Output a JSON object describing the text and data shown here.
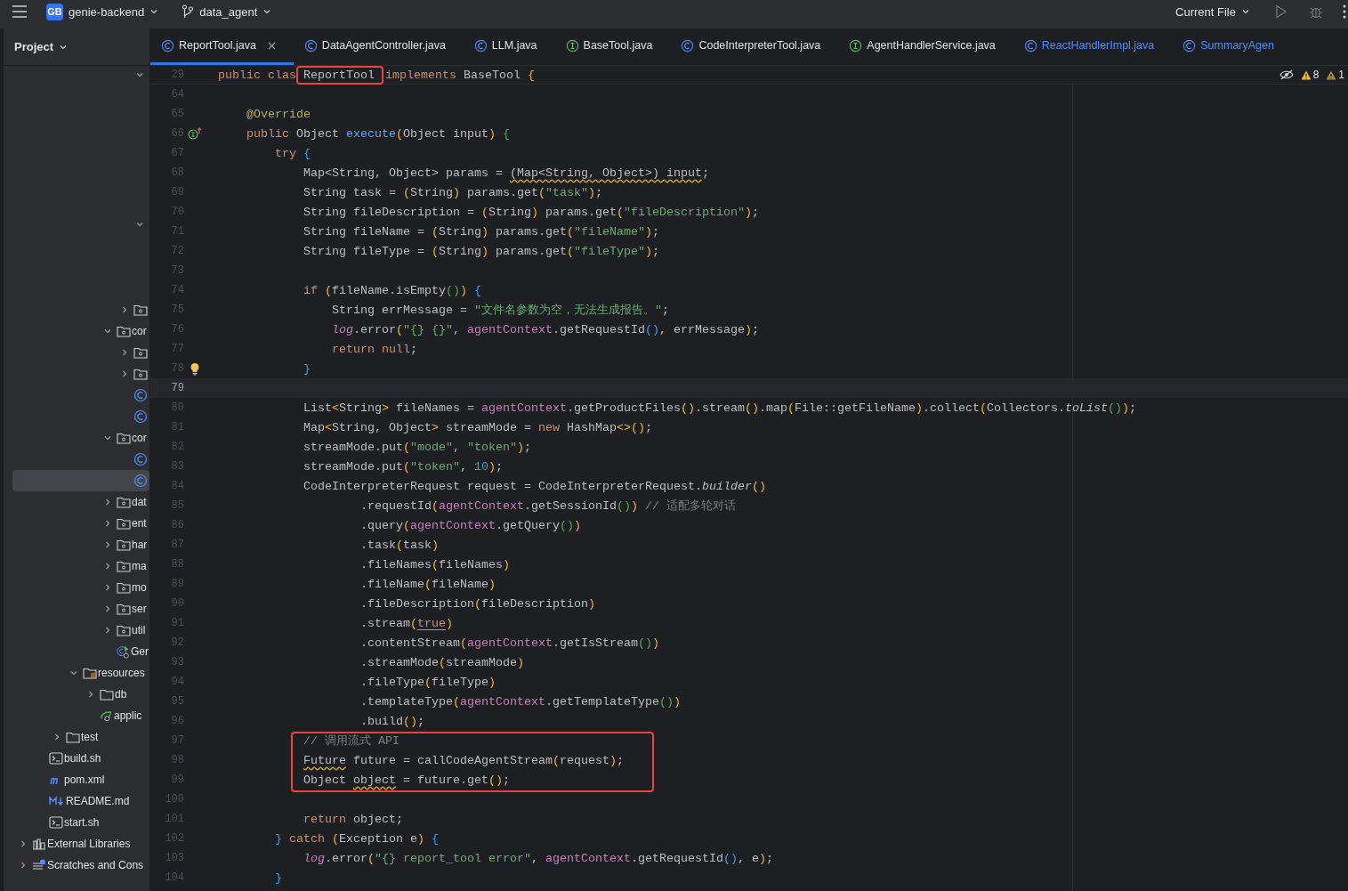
{
  "top_bar": {
    "project": {
      "badge": "GB",
      "name": "genie-backend"
    },
    "branch": "data_agent",
    "run_config": "Current File"
  },
  "sidebar": {
    "title": "Project",
    "tree": [
      {
        "kind": "continued",
        "children": [
          {
            "kind": "continued",
            "children": [
              {
                "kind": "continued",
                "children": [
                  {
                    "kind": "continued",
                    "children": [
                      {
                        "kind": "continued",
                        "children": [
                          {
                            "kind": "continued",
                            "children": [
                              {
                                "kind": "folder",
                                "expanded": false,
                                "selected": false
                              }
                            ]
                          },
                          {
                            "kind": "folder",
                            "label": "cor",
                            "expanded": true,
                            "selected": false,
                            "children": [
                              {
                                "kind": "folder",
                                "expanded": false,
                                "selected": false
                              },
                              {
                                "kind": "folder",
                                "expanded": false,
                                "selected": false
                              },
                              {
                                "kind": "class",
                                "selected": false
                              },
                              {
                                "kind": "class",
                                "selected": false
                              }
                            ]
                          },
                          {
                            "kind": "folder",
                            "label": "cor",
                            "expanded": true,
                            "selected": false,
                            "children": [
                              {
                                "kind": "class",
                                "selected": false
                              },
                              {
                                "kind": "class",
                                "selected": true
                              }
                            ]
                          },
                          {
                            "kind": "folder",
                            "label": "dat",
                            "expanded": false,
                            "selected": false
                          },
                          {
                            "kind": "folder",
                            "label": "ent",
                            "expanded": false,
                            "selected": false
                          },
                          {
                            "kind": "folder",
                            "label": "har",
                            "expanded": false,
                            "selected": false
                          },
                          {
                            "kind": "folder",
                            "label": "ma",
                            "expanded": false,
                            "selected": false
                          },
                          {
                            "kind": "folder",
                            "label": "mo",
                            "expanded": false,
                            "selected": false
                          },
                          {
                            "kind": "folder",
                            "label": "ser",
                            "expanded": false,
                            "selected": false
                          },
                          {
                            "kind": "folder",
                            "label": "util",
                            "expanded": false,
                            "selected": false
                          },
                          {
                            "kind": "spring-class",
                            "label": "Ger",
                            "selected": false
                          }
                        ]
                      }
                    ]
                  },
                  {
                    "kind": "resources-folder",
                    "label": "resources",
                    "expanded": true,
                    "selected": false,
                    "children": [
                      {
                        "kind": "plain-folder",
                        "label": "db",
                        "expanded": false,
                        "selected": false
                      },
                      {
                        "kind": "spring-config",
                        "label": "applic",
                        "selected": false
                      }
                    ]
                  }
                ]
              },
              {
                "kind": "plain-folder",
                "label": "test",
                "expanded": false,
                "selected": false
              }
            ]
          },
          {
            "kind": "shell-file",
            "label": "build.sh",
            "selected": false
          },
          {
            "kind": "maven-file",
            "label": "pom.xml",
            "selected": false
          },
          {
            "kind": "markdown-file",
            "label": "README.md",
            "selected": false
          },
          {
            "kind": "shell-file",
            "label": "start.sh",
            "selected": false
          }
        ]
      },
      {
        "kind": "libraries",
        "label": "External Libraries",
        "expanded": false,
        "selected": false
      },
      {
        "kind": "scratches",
        "label": "Scratches and Cons",
        "expanded": false,
        "selected": false
      }
    ]
  },
  "tabs": [
    {
      "label": "ReportTool.java",
      "kind": "class",
      "modified": false,
      "selected": true
    },
    {
      "label": "DataAgentController.java",
      "kind": "class",
      "modified": false,
      "selected": false
    },
    {
      "label": "LLM.java",
      "kind": "class",
      "modified": false,
      "selected": false
    },
    {
      "label": "BaseTool.java",
      "kind": "interface",
      "modified": false,
      "selected": false
    },
    {
      "label": "CodeInterpreterTool.java",
      "kind": "class",
      "modified": false,
      "selected": false
    },
    {
      "label": "AgentHandlerService.java",
      "kind": "interface",
      "modified": false,
      "selected": false
    },
    {
      "label": "ReactHandlerImpl.java",
      "kind": "class",
      "modified": true,
      "selected": false
    },
    {
      "label": "SummaryAgen",
      "kind": "class",
      "modified": true,
      "selected": false
    }
  ],
  "editor": {
    "sticky": {
      "number": "29",
      "tokens": [
        {
          "text": "public clas",
          "kind": "kw"
        },
        {
          "text": "ReportTool",
          "kind": "boxed"
        },
        {
          "text": "implements",
          "kind": "kw"
        },
        {
          "text": " BaseTool "
        },
        {
          "text": "{",
          "kind": "b1"
        }
      ]
    },
    "warnings": "8",
    "weak_warnings": "1",
    "segments": [
      {
        "boxed": false,
        "lines": [
          {
            "number": "64",
            "kind": "code",
            "current": false
          },
          {
            "number": "65",
            "kind": "code",
            "current": false,
            "tokens": [
              {
                "text": "    @Override",
                "kind": "ann"
              }
            ]
          },
          {
            "number": "66",
            "kind": "implementation",
            "current": false,
            "tokens": [
              {
                "text": "    public",
                "kind": "kw"
              },
              {
                "text": " Object "
              },
              {
                "text": "execute",
                "kind": "fn"
              },
              {
                "text": "(",
                "kind": "b1"
              },
              {
                "text": "Object input"
              },
              {
                "text": ") ",
                "kind": "b1"
              },
              {
                "text": "{",
                "kind": "b2"
              }
            ]
          },
          {
            "number": "67",
            "kind": "code",
            "current": false,
            "tokens": [
              {
                "text": "        try ",
                "kind": "kw"
              },
              {
                "text": "{",
                "kind": "b3"
              }
            ]
          },
          {
            "number": "68",
            "kind": "code",
            "current": false,
            "tokens": [
              {
                "text": "            Map<String, Object> params = "
              },
              {
                "text": "(Map<String, Object>)",
                "kind": "warn"
              },
              {
                "text": " input",
                "kind": "warn"
              },
              {
                "text": ";"
              }
            ]
          },
          {
            "number": "69",
            "kind": "code",
            "current": false,
            "tokens": [
              {
                "text": "            String task = "
              },
              {
                "text": "(",
                "kind": "b1"
              },
              {
                "text": "String"
              },
              {
                "text": ")",
                "kind": "b1"
              },
              {
                "text": " params.get"
              },
              {
                "text": "(",
                "kind": "b1"
              },
              {
                "text": "\"task\"",
                "kind": "str"
              },
              {
                "text": ")",
                "kind": "b1"
              },
              {
                "text": ";"
              }
            ]
          },
          {
            "number": "70",
            "kind": "code",
            "current": false,
            "tokens": [
              {
                "text": "            String fileDescription = "
              },
              {
                "text": "(",
                "kind": "b1"
              },
              {
                "text": "String"
              },
              {
                "text": ")",
                "kind": "b1"
              },
              {
                "text": " params.get"
              },
              {
                "text": "(",
                "kind": "b1"
              },
              {
                "text": "\"fileDescription\"",
                "kind": "str"
              },
              {
                "text": ")",
                "kind": "b1"
              },
              {
                "text": ";"
              }
            ]
          },
          {
            "number": "71",
            "kind": "code",
            "current": false,
            "tokens": [
              {
                "text": "            String fileName = "
              },
              {
                "text": "(",
                "kind": "b1"
              },
              {
                "text": "String"
              },
              {
                "text": ")",
                "kind": "b1"
              },
              {
                "text": " params.get"
              },
              {
                "text": "(",
                "kind": "b1"
              },
              {
                "text": "\"fileName\"",
                "kind": "str"
              },
              {
                "text": ")",
                "kind": "b1"
              },
              {
                "text": ";"
              }
            ]
          },
          {
            "number": "72",
            "kind": "code",
            "current": false,
            "tokens": [
              {
                "text": "            String fileType = "
              },
              {
                "text": "(",
                "kind": "b1"
              },
              {
                "text": "String"
              },
              {
                "text": ")",
                "kind": "b1"
              },
              {
                "text": " params.get"
              },
              {
                "text": "(",
                "kind": "b1"
              },
              {
                "text": "\"fileType\"",
                "kind": "str"
              },
              {
                "text": ")",
                "kind": "b1"
              },
              {
                "text": ";"
              }
            ]
          },
          {
            "number": "73",
            "kind": "code",
            "current": false
          },
          {
            "number": "74",
            "kind": "code",
            "current": false,
            "tokens": [
              {
                "text": "            if ",
                "kind": "kw"
              },
              {
                "text": "(",
                "kind": "b1"
              },
              {
                "text": "fileName.isEmpty"
              },
              {
                "text": "()",
                "kind": "b2"
              },
              {
                "text": ") ",
                "kind": "b1"
              },
              {
                "text": "{",
                "kind": "b3"
              }
            ]
          },
          {
            "number": "75",
            "kind": "code",
            "current": false,
            "tokens": [
              {
                "text": "                String errMessage = "
              },
              {
                "text": "\"文件名参数为空，无法生成报告。\"",
                "kind": "str"
              },
              {
                "text": ";"
              }
            ]
          },
          {
            "number": "76",
            "kind": "code",
            "current": false,
            "tokens": [
              {
                "text": "                log",
                "kind": "field-i"
              },
              {
                "text": ".error"
              },
              {
                "text": "(",
                "kind": "b1"
              },
              {
                "text": "\"{} {}\"",
                "kind": "str"
              },
              {
                "text": ", "
              },
              {
                "text": "agentContext",
                "kind": "field"
              },
              {
                "text": ".getRequestId"
              },
              {
                "text": "()",
                "kind": "b3"
              },
              {
                "text": ", errMessage"
              },
              {
                "text": ")",
                "kind": "b1"
              },
              {
                "text": ";"
              }
            ]
          },
          {
            "number": "77",
            "kind": "code",
            "current": false,
            "tokens": [
              {
                "text": "                return null",
                "kind": "kw"
              },
              {
                "text": ";"
              }
            ]
          },
          {
            "number": "78",
            "kind": "intention",
            "current": false,
            "tokens": [
              {
                "text": "            }",
                "kind": "b3"
              }
            ]
          },
          {
            "number": "79",
            "kind": "code",
            "current": true
          },
          {
            "number": "80",
            "kind": "code",
            "current": false,
            "tokens": [
              {
                "text": "            List"
              },
              {
                "text": "<",
                "kind": "b1"
              },
              {
                "text": "String"
              },
              {
                "text": ">",
                "kind": "b1"
              },
              {
                "text": " fileNames = "
              },
              {
                "text": "agentContext",
                "kind": "field"
              },
              {
                "text": ".getProductFiles"
              },
              {
                "text": "()",
                "kind": "b1"
              },
              {
                "text": ".stream"
              },
              {
                "text": "()",
                "kind": "b1"
              },
              {
                "text": ".map"
              },
              {
                "text": "(",
                "kind": "b1"
              },
              {
                "text": "File::getFileName"
              },
              {
                "text": ")",
                "kind": "b1"
              },
              {
                "text": ".collect"
              },
              {
                "text": "(",
                "kind": "b1"
              },
              {
                "text": "Collectors."
              },
              {
                "text": "toList",
                "kind": "italic"
              },
              {
                "text": "()",
                "kind": "b2"
              },
              {
                "text": ")",
                "kind": "b1"
              },
              {
                "text": ";"
              }
            ]
          },
          {
            "number": "81",
            "kind": "code",
            "current": false,
            "tokens": [
              {
                "text": "            Map"
              },
              {
                "text": "<",
                "kind": "b1"
              },
              {
                "text": "String, Object"
              },
              {
                "text": ">",
                "kind": "b1"
              },
              {
                "text": " streamMode = "
              },
              {
                "text": "new",
                "kind": "kw"
              },
              {
                "text": " HashMap"
              },
              {
                "text": "<>",
                "kind": "b1"
              },
              {
                "text": "()",
                "kind": "b1"
              },
              {
                "text": ";"
              }
            ]
          },
          {
            "number": "82",
            "kind": "code",
            "current": false,
            "tokens": [
              {
                "text": "            streamMode.put"
              },
              {
                "text": "(",
                "kind": "b1"
              },
              {
                "text": "\"mode\"",
                "kind": "str"
              },
              {
                "text": ", "
              },
              {
                "text": "\"token\"",
                "kind": "str"
              },
              {
                "text": ")",
                "kind": "b1"
              },
              {
                "text": ";"
              }
            ]
          },
          {
            "number": "83",
            "kind": "code",
            "current": false,
            "tokens": [
              {
                "text": "            streamMode.put"
              },
              {
                "text": "(",
                "kind": "b1"
              },
              {
                "text": "\"token\"",
                "kind": "str"
              },
              {
                "text": ", "
              },
              {
                "text": "10",
                "kind": "num"
              },
              {
                "text": ")",
                "kind": "b1"
              },
              {
                "text": ";"
              }
            ]
          },
          {
            "number": "84",
            "kind": "code",
            "current": false,
            "tokens": [
              {
                "text": "            CodeInterpreterRequest request = CodeInterpreterRequest."
              },
              {
                "text": "builder",
                "kind": "italic"
              },
              {
                "text": "()",
                "kind": "b1"
              }
            ]
          },
          {
            "number": "85",
            "kind": "code",
            "current": false,
            "tokens": [
              {
                "text": "                    .requestId"
              },
              {
                "text": "(",
                "kind": "b1"
              },
              {
                "text": "agentContext",
                "kind": "field"
              },
              {
                "text": ".getSessionId"
              },
              {
                "text": "()",
                "kind": "b2"
              },
              {
                "text": ") ",
                "kind": "b1"
              },
              {
                "text": "// 适配多轮对话",
                "kind": "cmt"
              }
            ]
          },
          {
            "number": "86",
            "kind": "code",
            "current": false,
            "tokens": [
              {
                "text": "                    .query"
              },
              {
                "text": "(",
                "kind": "b1"
              },
              {
                "text": "agentContext",
                "kind": "field"
              },
              {
                "text": ".getQuery"
              },
              {
                "text": "()",
                "kind": "b2"
              },
              {
                "text": ")",
                "kind": "b1"
              }
            ]
          },
          {
            "number": "87",
            "kind": "code",
            "current": false,
            "tokens": [
              {
                "text": "                    .task"
              },
              {
                "text": "(",
                "kind": "b1"
              },
              {
                "text": "task"
              },
              {
                "text": ")",
                "kind": "b1"
              }
            ]
          },
          {
            "number": "88",
            "kind": "code",
            "current": false,
            "tokens": [
              {
                "text": "                    .fileNames"
              },
              {
                "text": "(",
                "kind": "b1"
              },
              {
                "text": "fileNames"
              },
              {
                "text": ")",
                "kind": "b1"
              }
            ]
          },
          {
            "number": "89",
            "kind": "code",
            "current": false,
            "tokens": [
              {
                "text": "                    .fileName"
              },
              {
                "text": "(",
                "kind": "b1"
              },
              {
                "text": "fileName"
              },
              {
                "text": ")",
                "kind": "b1"
              }
            ]
          },
          {
            "number": "90",
            "kind": "code",
            "current": false,
            "tokens": [
              {
                "text": "                    .fileDescription"
              },
              {
                "text": "(",
                "kind": "b1"
              },
              {
                "text": "fileDescription"
              },
              {
                "text": ")",
                "kind": "b1"
              }
            ]
          },
          {
            "number": "91",
            "kind": "code",
            "current": false,
            "tokens": [
              {
                "text": "                    .stream"
              },
              {
                "text": "(",
                "kind": "b1"
              },
              {
                "text": "true",
                "kind": "kwu"
              },
              {
                "text": ")",
                "kind": "b1"
              }
            ]
          },
          {
            "number": "92",
            "kind": "code",
            "current": false,
            "tokens": [
              {
                "text": "                    .contentStream"
              },
              {
                "text": "(",
                "kind": "b1"
              },
              {
                "text": "agentContext",
                "kind": "field"
              },
              {
                "text": ".getIsStream"
              },
              {
                "text": "()",
                "kind": "b2"
              },
              {
                "text": ")",
                "kind": "b1"
              }
            ]
          },
          {
            "number": "93",
            "kind": "code",
            "current": false,
            "tokens": [
              {
                "text": "                    .streamMode"
              },
              {
                "text": "(",
                "kind": "b1"
              },
              {
                "text": "streamMode"
              },
              {
                "text": ")",
                "kind": "b1"
              }
            ]
          },
          {
            "number": "94",
            "kind": "code",
            "current": false,
            "tokens": [
              {
                "text": "                    .fileType"
              },
              {
                "text": "(",
                "kind": "b1"
              },
              {
                "text": "fileType"
              },
              {
                "text": ")",
                "kind": "b1"
              }
            ]
          },
          {
            "number": "95",
            "kind": "code",
            "current": false,
            "tokens": [
              {
                "text": "                    .templateType"
              },
              {
                "text": "(",
                "kind": "b1"
              },
              {
                "text": "agentContext",
                "kind": "field"
              },
              {
                "text": ".getTemplateType"
              },
              {
                "text": "()",
                "kind": "b2"
              },
              {
                "text": ")",
                "kind": "b1"
              }
            ]
          },
          {
            "number": "96",
            "kind": "code",
            "current": false,
            "tokens": [
              {
                "text": "                    .build"
              },
              {
                "text": "()",
                "kind": "b1"
              },
              {
                "text": ";"
              }
            ]
          }
        ]
      },
      {
        "boxed": true,
        "lines": [
          {
            "number": "97",
            "kind": "code",
            "current": false,
            "tokens": [
              {
                "text": "            // 调用流式 API",
                "kind": "cmt"
              }
            ]
          },
          {
            "number": "98",
            "kind": "code",
            "current": false,
            "tokens": [
              {
                "text": "            Future",
                "kind": "warn"
              },
              {
                "text": " future = callCodeAgentStream"
              },
              {
                "text": "(",
                "kind": "b1"
              },
              {
                "text": "request"
              },
              {
                "text": ")",
                "kind": "b1"
              },
              {
                "text": ";"
              }
            ]
          },
          {
            "number": "99",
            "kind": "code",
            "current": false,
            "tokens": [
              {
                "text": "            Object "
              },
              {
                "text": "object",
                "kind": "warn"
              },
              {
                "text": " = future.get"
              },
              {
                "text": "()",
                "kind": "b1"
              },
              {
                "text": ";"
              }
            ]
          }
        ]
      },
      {
        "boxed": false,
        "lines": [
          {
            "number": "100",
            "kind": "code",
            "current": false
          },
          {
            "number": "101",
            "kind": "code",
            "current": false,
            "tokens": [
              {
                "text": "            return",
                "kind": "kw"
              },
              {
                "text": " object;"
              }
            ]
          },
          {
            "number": "102",
            "kind": "code",
            "current": false,
            "tokens": [
              {
                "text": "        } ",
                "kind": "b3"
              },
              {
                "text": "catch ",
                "kind": "kw"
              },
              {
                "text": "(",
                "kind": "b1"
              },
              {
                "text": "Exception e"
              },
              {
                "text": ") ",
                "kind": "b1"
              },
              {
                "text": "{",
                "kind": "b3"
              }
            ]
          },
          {
            "number": "103",
            "kind": "code",
            "current": false,
            "tokens": [
              {
                "text": "            log",
                "kind": "field-i"
              },
              {
                "text": ".error"
              },
              {
                "text": "(",
                "kind": "b1"
              },
              {
                "text": "\"{} report_tool error\"",
                "kind": "str"
              },
              {
                "text": ", "
              },
              {
                "text": "agentContext",
                "kind": "field"
              },
              {
                "text": ".getRequestId"
              },
              {
                "text": "()",
                "kind": "b3"
              },
              {
                "text": ", e"
              },
              {
                "text": ")",
                "kind": "b1"
              },
              {
                "text": ";"
              }
            ]
          },
          {
            "number": "104",
            "kind": "code",
            "current": false,
            "tokens": [
              {
                "text": "        }",
                "kind": "b3"
              }
            ]
          }
        ]
      }
    ]
  }
}
